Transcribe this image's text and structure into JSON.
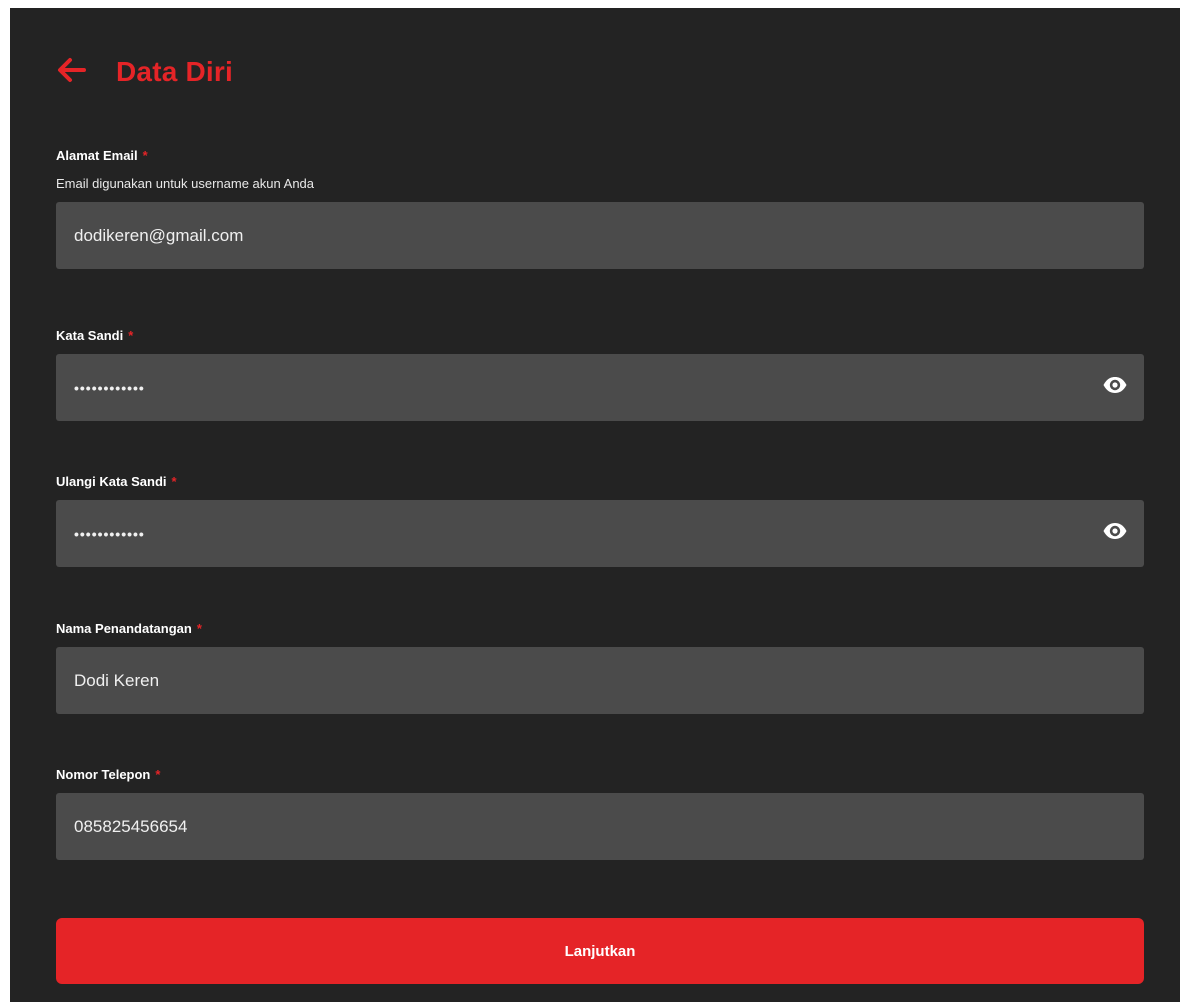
{
  "header": {
    "back_icon": "arrow-left-icon",
    "title": "Data Diri"
  },
  "accent_color": "#e52427",
  "form": {
    "email": {
      "label": "Alamat Email",
      "required_mark": "*",
      "hint": "Email digunakan untuk username akun Anda",
      "value": "dodikeren@gmail.com"
    },
    "password": {
      "label": "Kata Sandi",
      "required_mark": "*",
      "value": "••••••••••••",
      "toggle_icon": "eye-icon"
    },
    "password_confirm": {
      "label": "Ulangi Kata Sandi",
      "required_mark": "*",
      "value": "••••••••••••",
      "toggle_icon": "eye-icon"
    },
    "signer_name": {
      "label": "Nama Penandatangan",
      "required_mark": "*",
      "value": "Dodi Keren"
    },
    "phone": {
      "label": "Nomor Telepon",
      "required_mark": "*",
      "value": "085825456654"
    }
  },
  "actions": {
    "submit_label": "Lanjutkan"
  }
}
